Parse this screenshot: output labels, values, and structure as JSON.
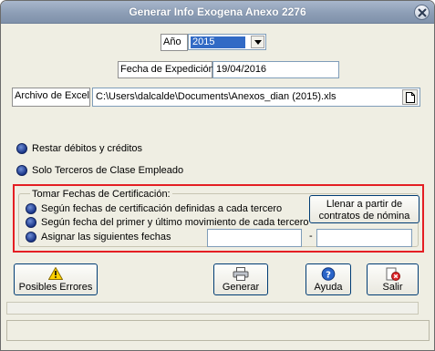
{
  "window": {
    "title": "Generar Info Exogena Anexo 2276"
  },
  "year": {
    "label": "Año",
    "value": "2015"
  },
  "expedition": {
    "label": "Fecha de Expedición",
    "value": "19/04/2016"
  },
  "excel": {
    "label": "Archivo de Excel",
    "value": "C:\\Users\\dalcalde\\Documents\\Anexos_dian (2015).xls"
  },
  "options": {
    "restar": "Restar débitos y créditos",
    "solo_terceros": "Solo Terceros de Clase Empleado"
  },
  "cert_group": {
    "legend": "Tomar Fechas de Certificación:",
    "opt1": "Según fechas de certificación definidas a cada tercero",
    "opt2": "Según fecha del primer y último movimiento de cada tercero",
    "opt3": "Asignar las siguientes fechas",
    "date_from": "",
    "date_to": "",
    "separator": "-",
    "fill_button_line1": "Llenar a partir de",
    "fill_button_line2": "contratos de nómina"
  },
  "buttons": {
    "errors": "Posibles Errores",
    "generate": "Generar",
    "help": "Ayuda",
    "exit": "Salir"
  },
  "colors": {
    "highlight_border": "#e41e23",
    "radio": "#1a3588",
    "title_bar": "#8d9eb6"
  }
}
